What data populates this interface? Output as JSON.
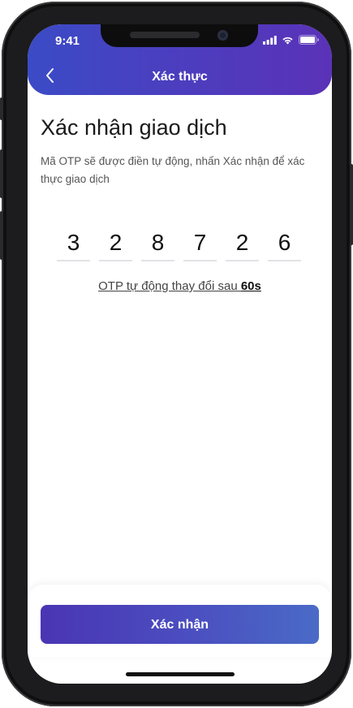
{
  "status_bar": {
    "time": "9:41",
    "icons": [
      "signal-icon",
      "wifi-icon",
      "battery-icon"
    ]
  },
  "header": {
    "title": "Xác thực",
    "back_icon": "chevron-left-icon"
  },
  "main": {
    "title": "Xác nhận giao dịch",
    "description": " Mã OTP sẽ được điền tự động, nhấn Xác nhận để xác thực giao dịch",
    "otp_digits": [
      "3",
      "2",
      "8",
      "7",
      "2",
      "6"
    ],
    "timer_text": "OTP tự động thay đổi sau ",
    "timer_seconds": "60s"
  },
  "footer": {
    "confirm_label": "Xác nhận"
  },
  "colors": {
    "header_gradient_start": "#3b4bc6",
    "header_gradient_end": "#5a32b8",
    "button_gradient_start": "#4a35b3",
    "button_gradient_end": "#4a6bc6"
  }
}
